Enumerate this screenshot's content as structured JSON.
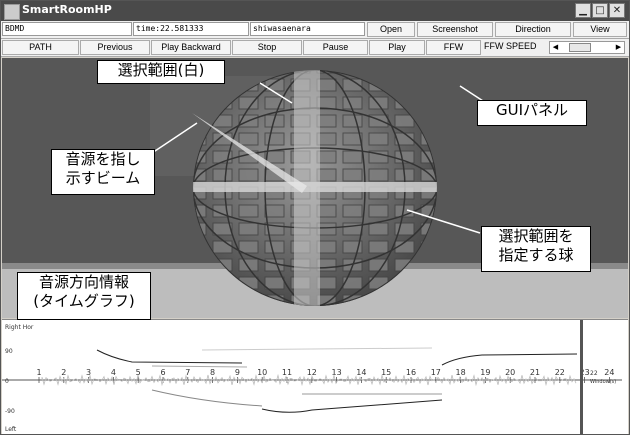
{
  "window": {
    "title": "SmartRoomHP",
    "min_icon": "minimize-icon",
    "max_icon": "maximize-icon",
    "close_icon": "close-icon"
  },
  "toolbar1": {
    "file_field": "BDMD",
    "time_field": "time:22.581333",
    "user_field": "shiwasaenara",
    "buttons": [
      "Open",
      "Screenshot",
      "Direction",
      "View"
    ]
  },
  "toolbar2": {
    "buttons": [
      "PATH",
      "Previous",
      "Play Backward",
      "Stop",
      "Pause",
      "Play",
      "FFW"
    ],
    "speed_label": "FFW SPEED",
    "speed_value": 0.25
  },
  "annotations": {
    "selection_range": "選択範囲(白)",
    "gui_panel": "GUIパネル",
    "beam_line1": "音源を指し",
    "beam_line2": "示すビーム",
    "sphere_line1": "選択範囲を",
    "sphere_line2": "指定する球",
    "graph_line1": "音源方向情報",
    "graph_line2": "(タイムグラフ)"
  },
  "graph": {
    "top_label": "Right Hor",
    "bottom_label": "Left",
    "y_labels": [
      "90",
      "0",
      "-90"
    ],
    "x_ticks": [
      "1",
      "2",
      "3",
      "4",
      "5",
      "6",
      "7",
      "8",
      "9",
      "10",
      "11",
      "12",
      "13",
      "14",
      "15",
      "16",
      "17",
      "18",
      "19",
      "20",
      "21",
      "22",
      "23",
      "24"
    ],
    "cursor_label": "22",
    "window_label": "Window(s)",
    "cursor_time": 22.581333
  }
}
